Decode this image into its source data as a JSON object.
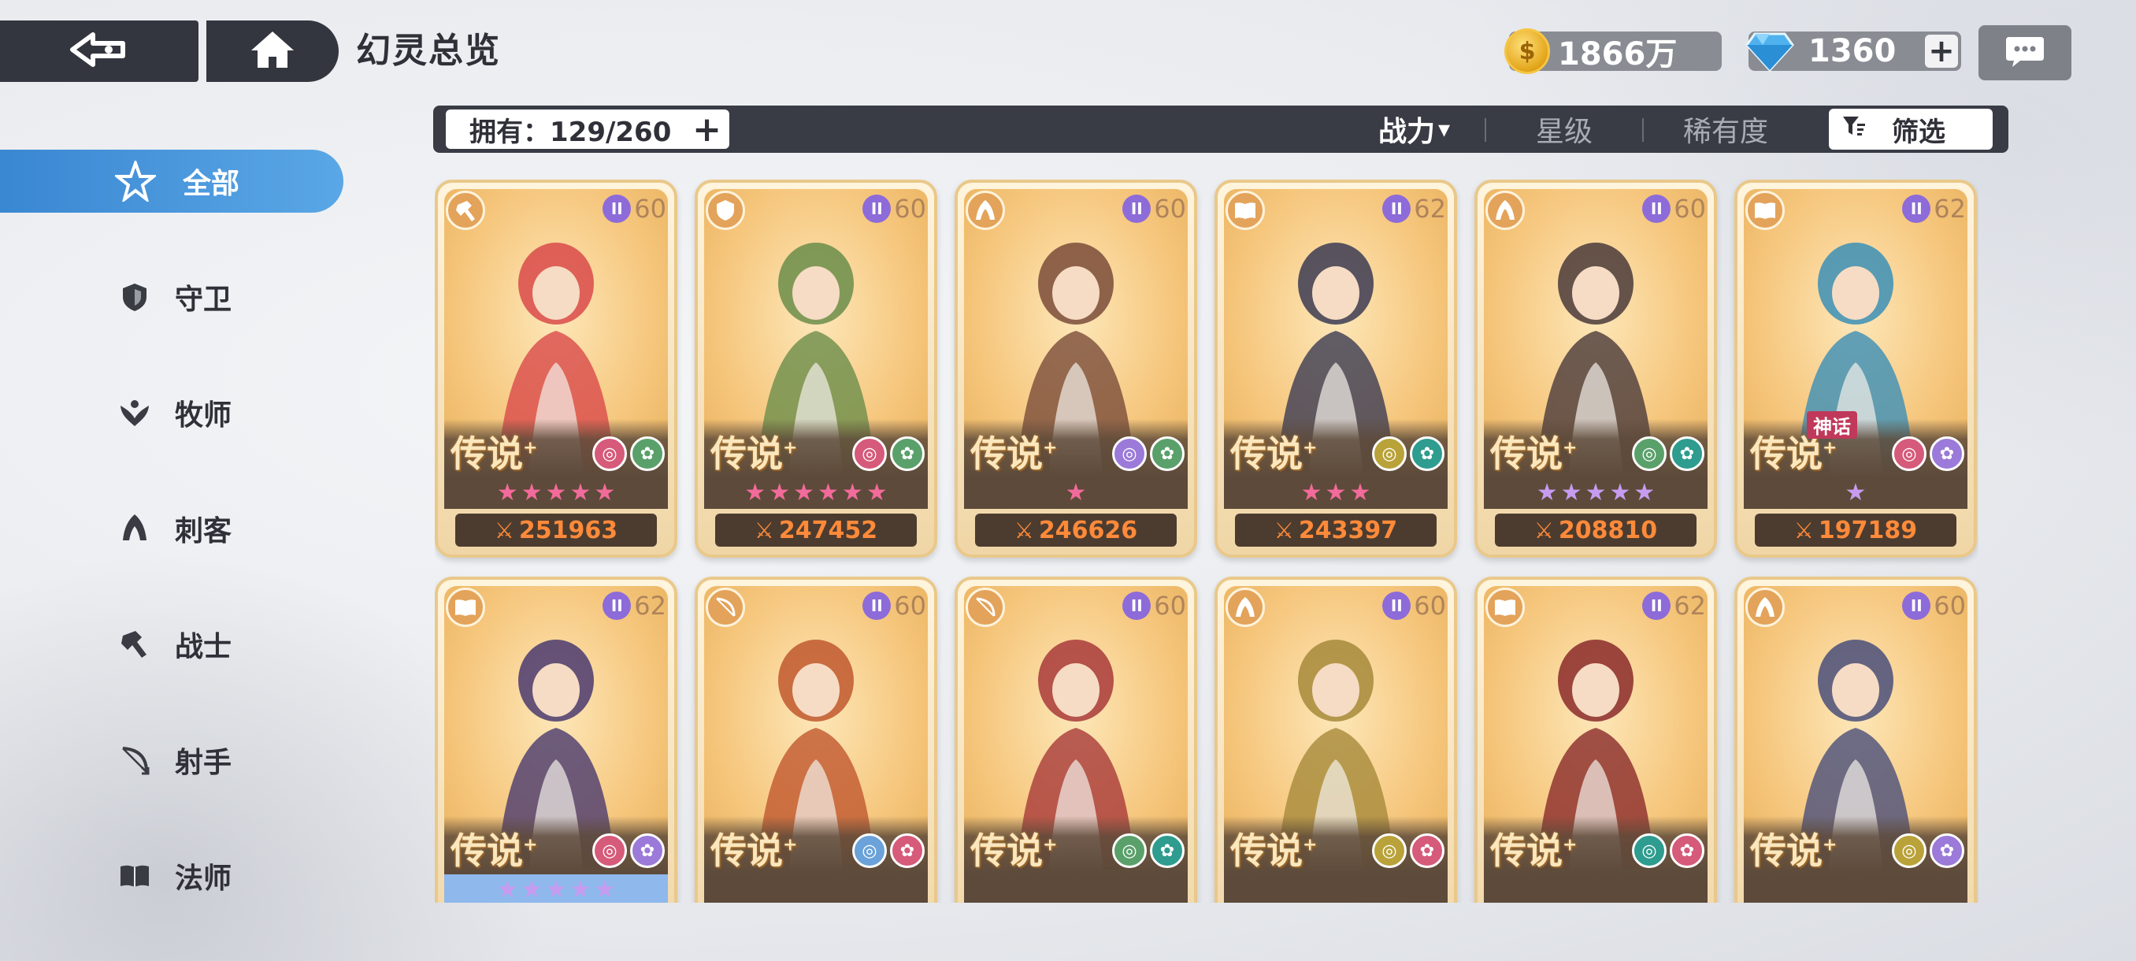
{
  "header": {
    "title": "幻灵总览",
    "gold": "1866万",
    "gems": "1360",
    "plus": "+",
    "coin_glyph": "$"
  },
  "sidebar": {
    "items": [
      {
        "label": "全部",
        "icon": "all-icon",
        "active": true
      },
      {
        "label": "守卫",
        "icon": "guard-shield-icon",
        "active": false
      },
      {
        "label": "牧师",
        "icon": "priest-icon",
        "active": false
      },
      {
        "label": "刺客",
        "icon": "assassin-icon",
        "active": false
      },
      {
        "label": "战士",
        "icon": "warrior-icon",
        "active": false
      },
      {
        "label": "射手",
        "icon": "archer-icon",
        "active": false
      },
      {
        "label": "法师",
        "icon": "mage-book-icon",
        "active": false
      }
    ]
  },
  "filterbar": {
    "owned": "拥有：129/260",
    "plus": "+",
    "sort_power": "战力",
    "sort_arrow": "▾",
    "sort_star": "星级",
    "sort_rarity": "稀有度",
    "filter_label": "筛选"
  },
  "colors": {
    "accent_blue": "#3a87d2",
    "power_orange": "#ff8a3a",
    "star_pink": "#f26b9a",
    "star_purple": "#c79cf0",
    "dark_bar": "#393b45"
  },
  "cards": [
    {
      "rank": "传说",
      "tier": "II",
      "level": "60",
      "stars": 5,
      "star_color": "#f26b9a",
      "power": "251963",
      "class_icon": "warrior-icon",
      "hue": "#d94a4a",
      "myth": ""
    },
    {
      "rank": "传说",
      "tier": "II",
      "level": "60",
      "stars": 6,
      "star_color": "#f26b9a",
      "power": "247452",
      "class_icon": "guard-shield-icon",
      "hue": "#6b8d4a",
      "myth": ""
    },
    {
      "rank": "传说",
      "tier": "II",
      "level": "60",
      "stars": 1,
      "star_color": "#f26b9a",
      "power": "246626",
      "class_icon": "assassin-icon",
      "hue": "#7a4c3a",
      "myth": ""
    },
    {
      "rank": "传说",
      "tier": "II",
      "level": "62",
      "stars": 3,
      "star_color": "#f26b9a",
      "power": "243397",
      "class_icon": "mage-book-icon",
      "hue": "#3b3b52",
      "myth": ""
    },
    {
      "rank": "传说",
      "tier": "II",
      "level": "60",
      "stars": 5,
      "star_color": "#c79cf0",
      "power": "208810",
      "class_icon": "assassin-icon",
      "hue": "#4a3a3a",
      "myth": ""
    },
    {
      "rank": "传说",
      "tier": "II",
      "level": "62",
      "stars": 1,
      "star_color": "#c79cf0",
      "power": "197189",
      "class_icon": "mage-book-icon",
      "hue": "#3b8fb6",
      "myth": "神话"
    },
    {
      "rank": "传说",
      "tier": "II",
      "level": "62",
      "stars": 5,
      "star_color": "#c79cf0",
      "power": "",
      "class_icon": "mage-book-icon",
      "hue": "#4a3a6e",
      "myth": "",
      "blue_stars": true
    },
    {
      "rank": "传说",
      "tier": "II",
      "level": "60",
      "stars": 0,
      "star_color": "#c79cf0",
      "power": "",
      "class_icon": "archer-icon",
      "hue": "#c0582e",
      "myth": ""
    },
    {
      "rank": "传说",
      "tier": "II",
      "level": "60",
      "stars": 0,
      "star_color": "#c79cf0",
      "power": "",
      "class_icon": "archer-icon",
      "hue": "#a83a3a",
      "myth": ""
    },
    {
      "rank": "传说",
      "tier": "II",
      "level": "60",
      "stars": 0,
      "star_color": "#c79cf0",
      "power": "",
      "class_icon": "assassin-icon",
      "hue": "#a68a3a",
      "myth": ""
    },
    {
      "rank": "传说",
      "tier": "II",
      "level": "62",
      "stars": 0,
      "star_color": "#c79cf0",
      "power": "",
      "class_icon": "mage-book-icon",
      "hue": "#8a2a2a",
      "myth": ""
    },
    {
      "rank": "传说",
      "tier": "II",
      "level": "60",
      "stars": 0,
      "star_color": "#c79cf0",
      "power": "",
      "class_icon": "assassin-icon",
      "hue": "#4a4f7a",
      "myth": ""
    }
  ]
}
